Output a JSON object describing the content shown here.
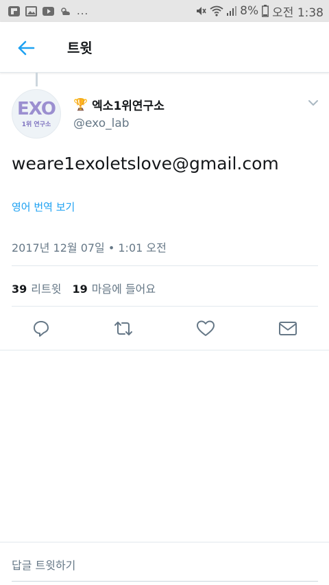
{
  "status_bar": {
    "notification_icons": [
      "flipboard-icon",
      "image-icon",
      "youtube-icon",
      "weather-icon"
    ],
    "more": "...",
    "battery": "8%",
    "time": "오전 1:38"
  },
  "header": {
    "title": "트윗"
  },
  "tweet": {
    "avatar_logo": "EXO",
    "avatar_sub": "1위 연구소",
    "display_name": "엑소1위연구소",
    "handle": "@exo_lab",
    "text": "weare1exoletslove@gmail.com",
    "translate_label": "영어 번역 보기",
    "timestamp": "2017년 12월 07일 • 1:01 오전",
    "retweet_count": "39",
    "retweet_label": "리트윗",
    "like_count": "19",
    "like_label": "마음에 들어요"
  },
  "colors": {
    "accent": "#1da1f2",
    "secondary_text": "#657786",
    "divider": "#e1e8ed"
  },
  "reply": {
    "placeholder": "답글 트윗하기"
  }
}
